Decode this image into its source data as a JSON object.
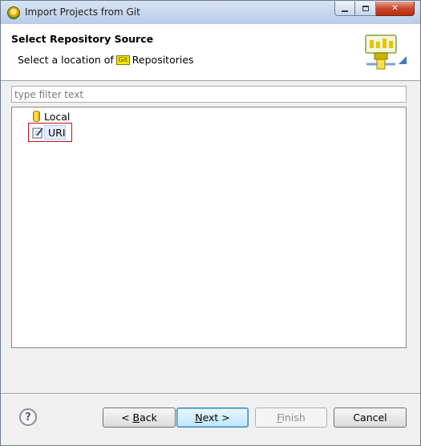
{
  "window": {
    "title": "Import Projects from Git",
    "icon": "eclipse-icon"
  },
  "banner": {
    "title": "Select Repository Source",
    "desc_prefix": "Select a location of",
    "git_badge": "Git",
    "desc_suffix": "Repositories",
    "icon": "wizard-banner-icon"
  },
  "filter": {
    "placeholder": "type filter text",
    "value": ""
  },
  "tree": {
    "items": [
      {
        "label": "Local",
        "icon": "database-icon"
      },
      {
        "label": "URI",
        "icon": "edit-uri-icon",
        "selected": true
      }
    ]
  },
  "buttons": {
    "help": "?",
    "back_prefix": "< ",
    "back_mnemonic": "B",
    "back_rest": "ack",
    "next_mnemonic": "N",
    "next_rest": "ext >",
    "finish_mnemonic": "F",
    "finish_rest": "inish",
    "cancel": "Cancel"
  },
  "colors": {
    "selection_outline": "#c0141a",
    "git_badge": "#f5e600"
  }
}
